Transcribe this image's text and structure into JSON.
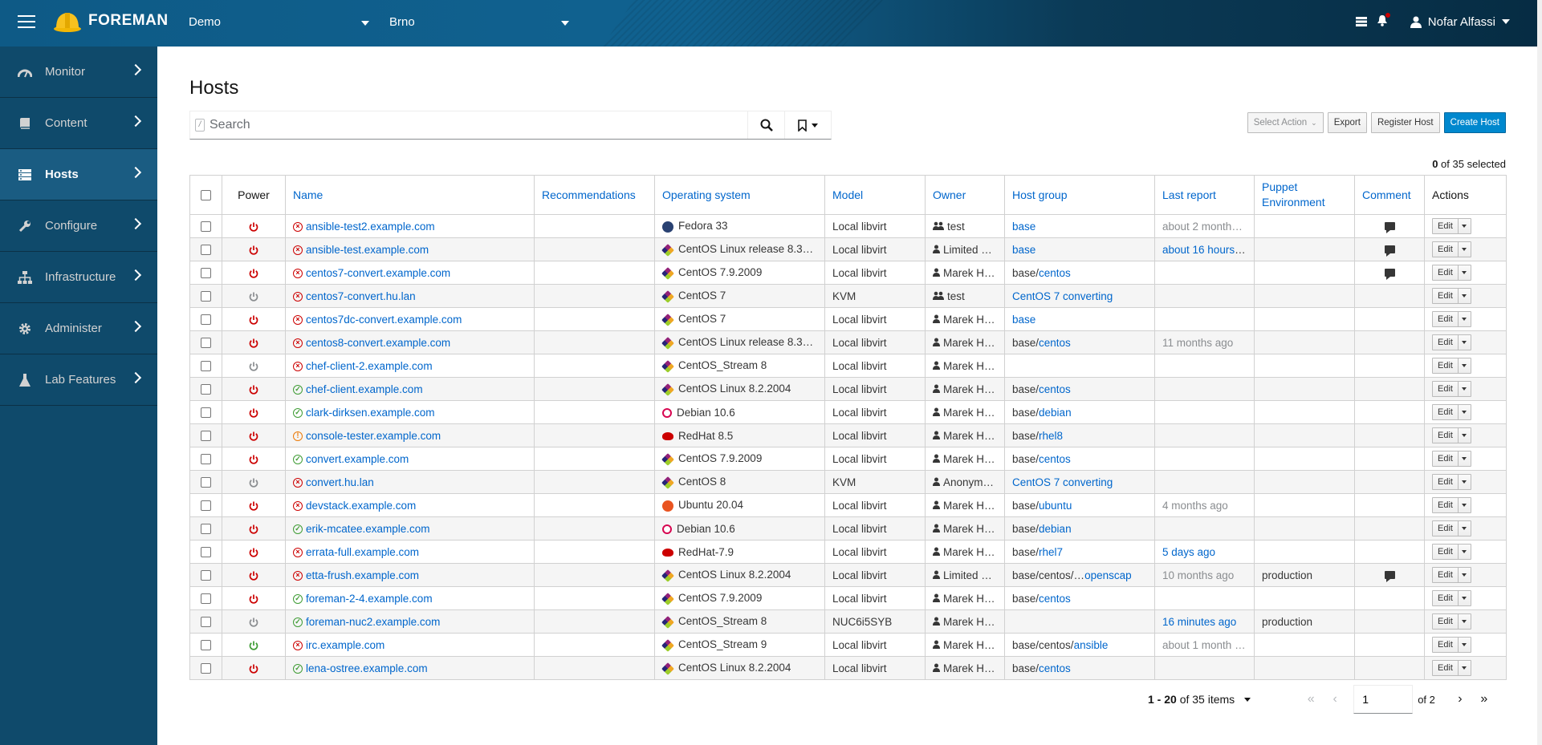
{
  "header": {
    "brand": "FOREMAN",
    "organization": "Demo",
    "location": "Brno",
    "user": "Nofar Alfassi",
    "icons": [
      "menu-icon",
      "tasks-icon",
      "notifications-icon",
      "user-icon"
    ]
  },
  "sidebar": {
    "items": [
      {
        "label": "Monitor",
        "icon": "dashboard-icon"
      },
      {
        "label": "Content",
        "icon": "book-icon"
      },
      {
        "label": "Hosts",
        "icon": "server-icon",
        "active": true
      },
      {
        "label": "Configure",
        "icon": "wrench-icon"
      },
      {
        "label": "Infrastructure",
        "icon": "network-icon"
      },
      {
        "label": "Administer",
        "icon": "gear-icon"
      },
      {
        "label": "Lab Features",
        "icon": "flask-icon"
      }
    ]
  },
  "page": {
    "title": "Hosts",
    "search_placeholder": "Search",
    "selected_text": "0",
    "selected_total": "of 35 selected"
  },
  "toolbar": {
    "select_action": "Select Action",
    "export": "Export",
    "register": "Register Host",
    "create": "Create Host"
  },
  "table": {
    "headers": {
      "power": "Power",
      "name": "Name",
      "recommendations": "Recommendations",
      "os": "Operating system",
      "model": "Model",
      "owner": "Owner",
      "hostgroup": "Host group",
      "last_report": "Last report",
      "puppet_env": "Puppet Environment",
      "comment": "Comment",
      "actions": "Actions"
    },
    "edit_label": "Edit",
    "rows": [
      {
        "power": "on",
        "status": "err",
        "name": "ansible-test2.example.com",
        "os": "Fedora 33",
        "os_icon": "fedora",
        "model": "Local libvirt",
        "owner": "test",
        "owner_icon": "group",
        "hg_base": "base",
        "hg_link": "",
        "hg_full_link": true,
        "last_report": "about 2 month…",
        "lr_style": "muted",
        "puppet": "",
        "comment": true
      },
      {
        "power": "on",
        "status": "err",
        "name": "ansible-test.example.com",
        "os": "CentOS Linux release 8.3…",
        "os_icon": "centos",
        "model": "Local libvirt",
        "owner": "Limited …",
        "owner_icon": "user",
        "hg_base": "base",
        "hg_link": "",
        "hg_full_link": true,
        "last_report": "about 16 hours …",
        "lr_style": "link",
        "puppet": "",
        "comment": true
      },
      {
        "power": "on",
        "status": "err",
        "name": "centos7-convert.example.com",
        "os": "CentOS 7.9.2009",
        "os_icon": "centos",
        "model": "Local libvirt",
        "owner": "Marek H…",
        "owner_icon": "user",
        "hg_base": "base/",
        "hg_link": "centos",
        "last_report": "",
        "puppet": "",
        "comment": true
      },
      {
        "power": "off",
        "status": "err",
        "name": "centos7-convert.hu.lan",
        "os": "CentOS 7",
        "os_icon": "centos",
        "model": "KVM",
        "owner": "test",
        "owner_icon": "group",
        "hg_base": "CentOS 7 converting",
        "hg_link": "",
        "hg_full_link": true,
        "last_report": "",
        "puppet": "",
        "comment": false
      },
      {
        "power": "on",
        "status": "err",
        "name": "centos7dc-convert.example.com",
        "os": "CentOS 7",
        "os_icon": "centos",
        "model": "Local libvirt",
        "owner": "Marek H…",
        "owner_icon": "user",
        "hg_base": "base",
        "hg_link": "",
        "hg_full_link": true,
        "last_report": "",
        "puppet": "",
        "comment": false
      },
      {
        "power": "on",
        "status": "err",
        "name": "centos8-convert.example.com",
        "os": "CentOS Linux release 8.3…",
        "os_icon": "centos",
        "model": "Local libvirt",
        "owner": "Marek H…",
        "owner_icon": "user",
        "hg_base": "base/",
        "hg_link": "centos",
        "last_report": "11 months ago",
        "lr_style": "muted",
        "puppet": "",
        "comment": false
      },
      {
        "power": "off",
        "status": "err",
        "name": "chef-client-2.example.com",
        "os": "CentOS_Stream 8",
        "os_icon": "centos",
        "model": "Local libvirt",
        "owner": "Marek H…",
        "owner_icon": "user",
        "hg_base": "",
        "hg_link": "",
        "last_report": "",
        "puppet": "",
        "comment": false
      },
      {
        "power": "on",
        "status": "ok",
        "name": "chef-client.example.com",
        "os": "CentOS Linux 8.2.2004",
        "os_icon": "centos",
        "model": "Local libvirt",
        "owner": "Marek H…",
        "owner_icon": "user",
        "hg_base": "base/",
        "hg_link": "centos",
        "last_report": "",
        "puppet": "",
        "comment": false
      },
      {
        "power": "on",
        "status": "ok",
        "name": "clark-dirksen.example.com",
        "os": "Debian 10.6",
        "os_icon": "debian",
        "model": "Local libvirt",
        "owner": "Marek H…",
        "owner_icon": "user",
        "hg_base": "base/",
        "hg_link": "debian",
        "last_report": "",
        "puppet": "",
        "comment": false
      },
      {
        "power": "on",
        "status": "warn",
        "name": "console-tester.example.com",
        "os": "RedHat 8.5",
        "os_icon": "redhat",
        "model": "Local libvirt",
        "owner": "Marek H…",
        "owner_icon": "user",
        "hg_base": "base/",
        "hg_link": "rhel8",
        "last_report": "",
        "puppet": "",
        "comment": false
      },
      {
        "power": "on",
        "status": "ok",
        "name": "convert.example.com",
        "os": "CentOS 7.9.2009",
        "os_icon": "centos",
        "model": "Local libvirt",
        "owner": "Marek H…",
        "owner_icon": "user",
        "hg_base": "base/",
        "hg_link": "centos",
        "last_report": "",
        "puppet": "",
        "comment": false
      },
      {
        "power": "off",
        "status": "err",
        "name": "convert.hu.lan",
        "os": "CentOS 8",
        "os_icon": "centos",
        "model": "KVM",
        "owner": "Anonym…",
        "owner_icon": "user",
        "hg_base": "CentOS 7 converting",
        "hg_link": "",
        "hg_full_link": true,
        "last_report": "",
        "puppet": "",
        "comment": false
      },
      {
        "power": "on",
        "status": "err",
        "name": "devstack.example.com",
        "os": "Ubuntu 20.04",
        "os_icon": "ubuntu",
        "model": "Local libvirt",
        "owner": "Marek H…",
        "owner_icon": "user",
        "hg_base": "base/",
        "hg_link": "ubuntu",
        "last_report": "4 months ago",
        "lr_style": "muted",
        "puppet": "",
        "comment": false
      },
      {
        "power": "on",
        "status": "ok",
        "name": "erik-mcatee.example.com",
        "os": "Debian 10.6",
        "os_icon": "debian",
        "model": "Local libvirt",
        "owner": "Marek H…",
        "owner_icon": "user",
        "hg_base": "base/",
        "hg_link": "debian",
        "last_report": "",
        "puppet": "",
        "comment": false
      },
      {
        "power": "on",
        "status": "err",
        "name": "errata-full.example.com",
        "os": "RedHat-7.9",
        "os_icon": "redhat",
        "model": "Local libvirt",
        "owner": "Marek H…",
        "owner_icon": "user",
        "hg_base": "base/",
        "hg_link": "rhel7",
        "last_report": "5 days ago",
        "lr_style": "link",
        "puppet": "",
        "comment": false
      },
      {
        "power": "on",
        "status": "err",
        "name": "etta-frush.example.com",
        "os": "CentOS Linux 8.2.2004",
        "os_icon": "centos",
        "model": "Local libvirt",
        "owner": "Limited …",
        "owner_icon": "user",
        "hg_base": "base/centos/…",
        "hg_link": "openscap",
        "last_report": "10 months ago",
        "lr_style": "muted",
        "puppet": "production",
        "comment": true
      },
      {
        "power": "on",
        "status": "ok",
        "name": "foreman-2-4.example.com",
        "os": "CentOS 7.9.2009",
        "os_icon": "centos",
        "model": "Local libvirt",
        "owner": "Marek H…",
        "owner_icon": "user",
        "hg_base": "base/",
        "hg_link": "centos",
        "last_report": "",
        "puppet": "",
        "comment": false
      },
      {
        "power": "off",
        "status": "ok",
        "name": "foreman-nuc2.example.com",
        "os": "CentOS_Stream 8",
        "os_icon": "centos",
        "model": "NUC6i5SYB",
        "owner": "Marek H…",
        "owner_icon": "user",
        "hg_base": "",
        "hg_link": "",
        "last_report": "16 minutes ago",
        "lr_style": "link",
        "puppet": "production",
        "comment": false
      },
      {
        "power": "green",
        "status": "err",
        "name": "irc.example.com",
        "os": "CentOS_Stream 9",
        "os_icon": "centos",
        "model": "Local libvirt",
        "owner": "Marek H…",
        "owner_icon": "user",
        "hg_base": "base/centos/",
        "hg_link": "ansible",
        "last_report": "about 1 month …",
        "lr_style": "muted",
        "puppet": "",
        "comment": false
      },
      {
        "power": "on",
        "status": "ok",
        "name": "lena-ostree.example.com",
        "os": "CentOS Linux 8.2.2004",
        "os_icon": "centos",
        "model": "Local libvirt",
        "owner": "Marek H…",
        "owner_icon": "user",
        "hg_base": "base/",
        "hg_link": "centos",
        "last_report": "",
        "puppet": "",
        "comment": false
      }
    ]
  },
  "pagination": {
    "range": "1 - 20",
    "of_items": "of 35 items",
    "current_page": "1",
    "of_pages": "of 2"
  },
  "colors": {
    "link": "#0066cc",
    "power_on": "#cc0000",
    "power_off": "#8a8d90",
    "power_green": "#3f9c35",
    "primary": "#0088ce"
  }
}
